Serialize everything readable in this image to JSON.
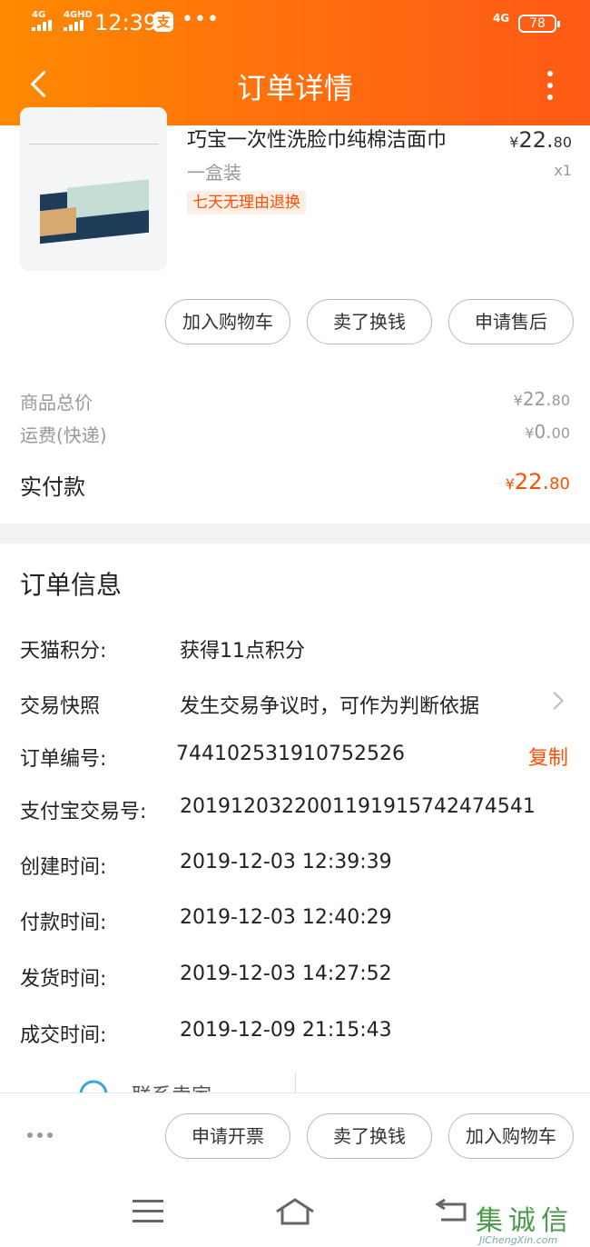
{
  "status_bar": {
    "sig1": "4G",
    "sig2": "4GHD",
    "time": "12:39",
    "alipay": "支",
    "more": "•••",
    "network": "4G",
    "battery": "78"
  },
  "header": {
    "title": "订单详情"
  },
  "product": {
    "name": "巧宝一次性洗脸巾纯棉洁面巾",
    "spec": "一盒装",
    "tag": "七天无理由退换",
    "price_symbol": "¥",
    "price_int": "22.",
    "price_dec": "80",
    "qty": "x1"
  },
  "product_actions": {
    "add_cart": "加入购物车",
    "sell": "卖了换钱",
    "after_sale": "申请售后"
  },
  "price_summary": {
    "subtotal_label": "商品总价",
    "subtotal_symbol": "¥",
    "subtotal_int": "22.",
    "subtotal_dec": "80",
    "shipping_label": "运费(快递)",
    "shipping_symbol": "¥",
    "shipping_int": "0.",
    "shipping_dec": "00",
    "paid_label": "实付款",
    "paid_symbol": "¥",
    "paid_int": "22.",
    "paid_dec": "80"
  },
  "order_info": {
    "title": "订单信息",
    "rows": [
      {
        "label": "天猫积分:",
        "value": "获得11点积分"
      },
      {
        "label": "交易快照",
        "value": "发生交易争议时，可作为判断依据"
      },
      {
        "label": "订单编号:",
        "value": "744102531910752526"
      },
      {
        "label": "支付宝交易号:",
        "value": "2019120322001191915742474541"
      },
      {
        "label": "创建时间:",
        "value": "2019-12-03 12:39:39"
      },
      {
        "label": "付款时间:",
        "value": "2019-12-03 12:40:29"
      },
      {
        "label": "发货时间:",
        "value": "2019-12-03 14:27:52"
      },
      {
        "label": "成交时间:",
        "value": "2019-12-09 21:15:43"
      }
    ],
    "copy_label": "复制"
  },
  "contact_peek": "联系卖家",
  "bottom_actions": {
    "invoice": "申请开票",
    "sell": "卖了换钱",
    "add_cart": "加入购物车"
  },
  "watermark": {
    "text": "集诚信",
    "sub": "JiChengXin.com"
  },
  "colors": {
    "accent": "#ff5000",
    "header_start": "#ff8a00",
    "header_end": "#ff5a17"
  }
}
